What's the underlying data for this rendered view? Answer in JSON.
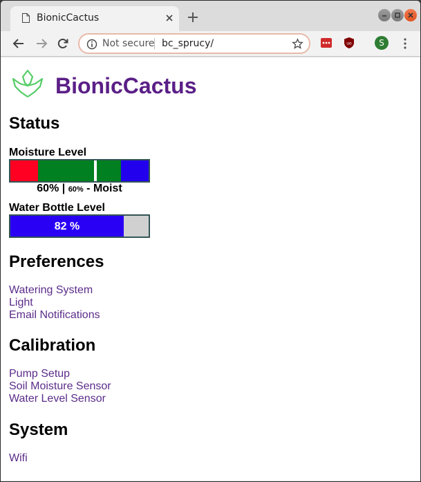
{
  "browser": {
    "tab_title": "BionicCactus",
    "security_label": "Not secure",
    "url": "bc_sprucy/",
    "avatar_initial": "S"
  },
  "header": {
    "brand_name": "BionicCactus"
  },
  "status": {
    "heading": "Status",
    "moisture": {
      "label": "Moisture Level",
      "value_text": "60%",
      "separator": " | ",
      "small_value": "60%",
      "state_text": " - Moist",
      "level": 0.6,
      "colors": {
        "dry": "#ff0022",
        "ok": "#008020",
        "wet": "#2200ee"
      }
    },
    "water_bottle": {
      "label": "Water Bottle Level",
      "value_text": "82 %",
      "level": 0.82,
      "fill_color": "#2a00f5"
    }
  },
  "preferences": {
    "heading": "Preferences",
    "links": [
      "Watering System",
      "Light",
      "Email Notifications"
    ]
  },
  "calibration": {
    "heading": "Calibration",
    "links": [
      "Pump Setup",
      "Soil Moisture Sensor",
      "Water Level Sensor"
    ]
  },
  "system": {
    "heading": "System",
    "links": [
      "Wifi"
    ]
  }
}
